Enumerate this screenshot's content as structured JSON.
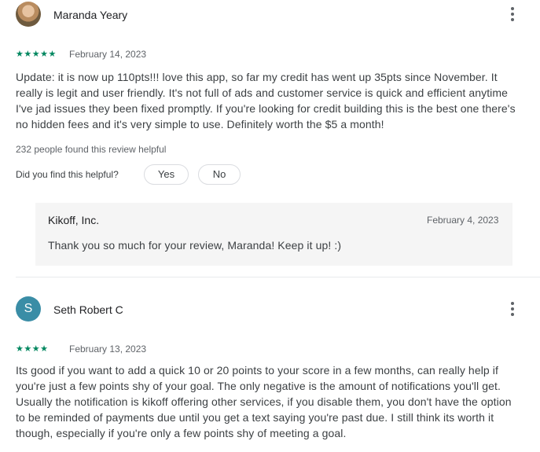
{
  "reviews": [
    {
      "author": "Maranda Yeary",
      "stars": "★★★★★",
      "rating": 5,
      "date": "February 14, 2023",
      "lines": [
        "Update: it is now up 110pts!!! love this app, so far my credit has went up 35pts since November. It",
        "really is legit and user friendly. It's not full of ads and customer service is quick and efficient anytime",
        "I've jad issues they been fixed promptly. If you're looking for credit building this is the best one there's",
        "no hidden fees and it's very simple to use. Definitely worth the $5 a month!"
      ],
      "helpful_count": "232 people found this review helpful",
      "helpful_question": "Did you find this helpful?",
      "yes_label": "Yes",
      "no_label": "No",
      "reply": {
        "developer": "Kikoff, Inc.",
        "date": "February 4, 2023",
        "text": "Thank you so much for your review, Maranda! Keep it up! :)"
      }
    },
    {
      "author": "Seth Robert C",
      "avatar_letter": "S",
      "stars": "★★★★",
      "rating": 4,
      "date": "February 13, 2023",
      "lines": [
        "Its good if you want to add a quick 10 or 20 points to your score in a few months, can really help if",
        "you're just a few points shy of your goal. The only negative is the amount of notifications you'll get.",
        "Usually the notification is kikoff offering other services, if you disable them, you don't have the option",
        "to be reminded of payments due until you get a text saying you're past due. I still think its worth it",
        "though, especially if you're only a few points shy of meeting a goal."
      ]
    }
  ],
  "colors": {
    "star": "#01875f",
    "avatar_bg": "#3a8da6",
    "reply_bg": "#f5f5f5"
  }
}
